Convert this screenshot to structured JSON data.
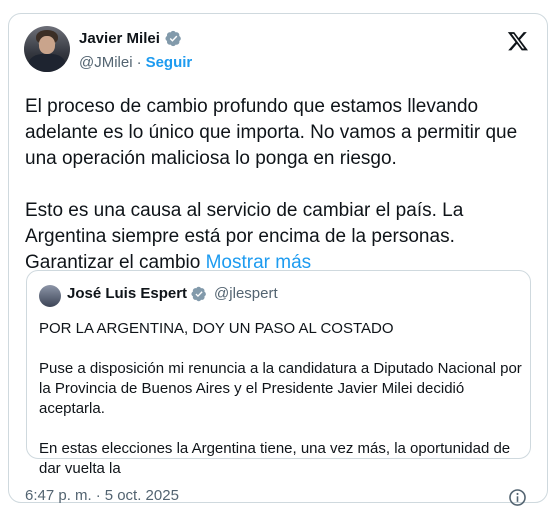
{
  "author": {
    "name": "Javier Milei",
    "handle": "@JMilei",
    "separator": "·",
    "follow_label": "Seguir"
  },
  "tweet": {
    "paragraph1": "El proceso de cambio profundo que estamos llevando adelante es lo único que importa. No vamos a permitir que una operación maliciosa lo ponga en riesgo.",
    "paragraph2": "Esto es una causa al servicio de cambiar el país. La Argentina siempre está por encima de la personas. Garantizar el cambio",
    "show_more": "Mostrar más"
  },
  "quote": {
    "name": "José Luis Espert",
    "handle": "@jlespert",
    "lines": [
      "POR LA ARGENTINA, DOY UN PASO AL COSTADO",
      "Puse a disposición mi renuncia a la candidatura a Diputado Nacional por la Provincia de Buenos Aires y el Presidente Javier Milei decidió aceptarla.",
      "En estas elecciones la Argentina tiene, una vez más, la oportunidad de dar vuelta la"
    ]
  },
  "footer": {
    "time": "6:47 p. m.",
    "separator": "·",
    "date": "5 oct. 2025"
  },
  "icons": {
    "verified": "verified-badge-icon",
    "platform": "x-logo-icon",
    "info": "info-icon"
  },
  "colors": {
    "accent": "#1d9bf0",
    "muted": "#536471",
    "border": "#cfd9de"
  }
}
